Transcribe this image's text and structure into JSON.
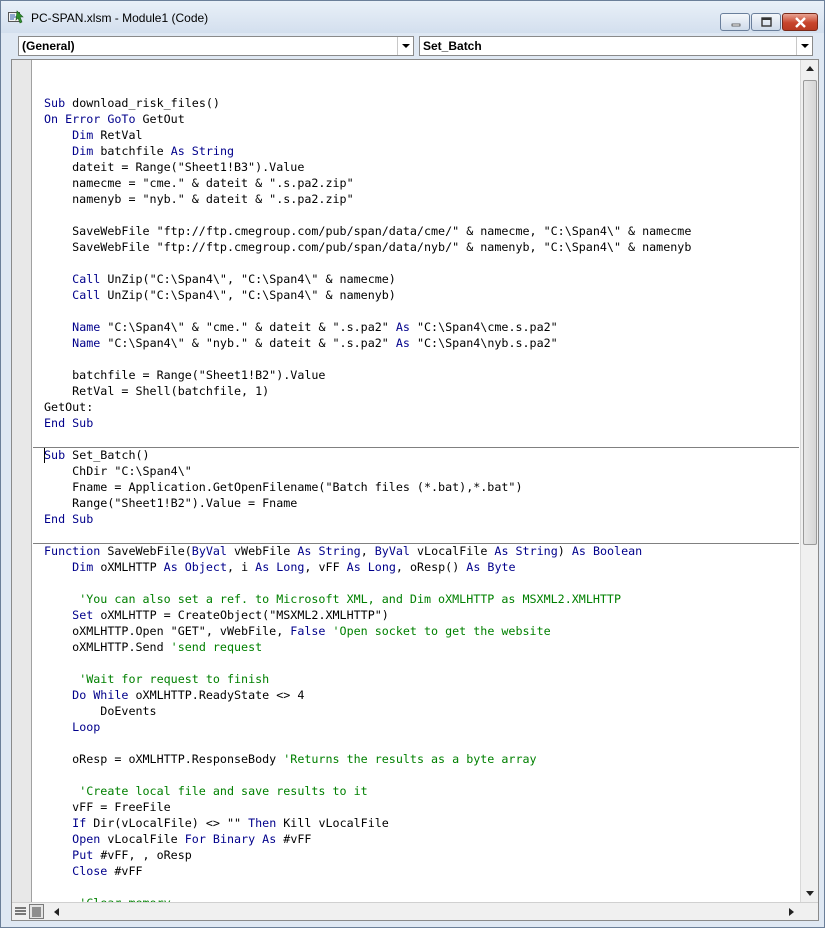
{
  "window": {
    "title": "PC-SPAN.xlsm - Module1 (Code)",
    "icon": "vba-module-icon",
    "accent_close": "#c8452c"
  },
  "combos": {
    "object": "(General)",
    "procedure": "Set_Batch"
  },
  "code_lines": [
    [
      [
        "",
        "plain"
      ]
    ],
    [
      [
        "Sub",
        "kw"
      ],
      [
        " download_risk_files()",
        "plain"
      ]
    ],
    [
      [
        "On Error GoTo",
        "kw"
      ],
      [
        " GetOut",
        "plain"
      ]
    ],
    [
      [
        "    ",
        "plain"
      ],
      [
        "Dim",
        "kw"
      ],
      [
        " RetVal",
        "plain"
      ]
    ],
    [
      [
        "    ",
        "plain"
      ],
      [
        "Dim",
        "kw"
      ],
      [
        " batchfile ",
        "plain"
      ],
      [
        "As String",
        "kw"
      ]
    ],
    [
      [
        "    dateit = Range(\"Sheet1!B3\").Value",
        "plain"
      ]
    ],
    [
      [
        "    namecme = \"cme.\" & dateit & \".s.pa2.zip\"",
        "plain"
      ]
    ],
    [
      [
        "    namenyb = \"nyb.\" & dateit & \".s.pa2.zip\"",
        "plain"
      ]
    ],
    [
      [
        "",
        "plain"
      ]
    ],
    [
      [
        "    SaveWebFile \"ftp://ftp.cmegroup.com/pub/span/data/cme/\" & namecme, \"C:\\Span4\\\" & namecme",
        "plain"
      ]
    ],
    [
      [
        "    SaveWebFile \"ftp://ftp.cmegroup.com/pub/span/data/nyb/\" & namenyb, \"C:\\Span4\\\" & namenyb",
        "plain"
      ]
    ],
    [
      [
        "",
        "plain"
      ]
    ],
    [
      [
        "    ",
        "plain"
      ],
      [
        "Call",
        "kw"
      ],
      [
        " UnZip(\"C:\\Span4\\\", \"C:\\Span4\\\" & namecme)",
        "plain"
      ]
    ],
    [
      [
        "    ",
        "plain"
      ],
      [
        "Call",
        "kw"
      ],
      [
        " UnZip(\"C:\\Span4\\\", \"C:\\Span4\\\" & namenyb)",
        "plain"
      ]
    ],
    [
      [
        "",
        "plain"
      ]
    ],
    [
      [
        "    ",
        "plain"
      ],
      [
        "Name",
        "kw"
      ],
      [
        " \"C:\\Span4\\\" & \"cme.\" & dateit & \".s.pa2\" ",
        "plain"
      ],
      [
        "As",
        "kw"
      ],
      [
        " \"C:\\Span4\\cme.s.pa2\"",
        "plain"
      ]
    ],
    [
      [
        "    ",
        "plain"
      ],
      [
        "Name",
        "kw"
      ],
      [
        " \"C:\\Span4\\\" & \"nyb.\" & dateit & \".s.pa2\" ",
        "plain"
      ],
      [
        "As",
        "kw"
      ],
      [
        " \"C:\\Span4\\nyb.s.pa2\"",
        "plain"
      ]
    ],
    [
      [
        "",
        "plain"
      ]
    ],
    [
      [
        "    batchfile = Range(\"Sheet1!B2\").Value",
        "plain"
      ]
    ],
    [
      [
        "    RetVal = Shell(batchfile, 1)",
        "plain"
      ]
    ],
    [
      [
        "GetOut:",
        "plain"
      ]
    ],
    [
      [
        "End Sub",
        "kw"
      ]
    ],
    [
      [
        "",
        "plain"
      ]
    ],
    [
      [
        "Sub",
        "kw"
      ],
      [
        " Set_Batch()",
        "plain"
      ]
    ],
    [
      [
        "    ChDir \"C:\\Span4\\\"",
        "plain"
      ]
    ],
    [
      [
        "    Fname = Application.GetOpenFilename(\"Batch files (*.bat),*.bat\")",
        "plain"
      ]
    ],
    [
      [
        "    Range(\"Sheet1!B2\").Value = Fname",
        "plain"
      ]
    ],
    [
      [
        "End Sub",
        "kw"
      ]
    ],
    [
      [
        "",
        "plain"
      ]
    ],
    [
      [
        "Function",
        "kw"
      ],
      [
        " SaveWebFile(",
        "plain"
      ],
      [
        "ByVal",
        "kw"
      ],
      [
        " vWebFile ",
        "plain"
      ],
      [
        "As String",
        "kw"
      ],
      [
        ", ",
        "plain"
      ],
      [
        "ByVal",
        "kw"
      ],
      [
        " vLocalFile ",
        "plain"
      ],
      [
        "As String",
        "kw"
      ],
      [
        ") ",
        "plain"
      ],
      [
        "As Boolean",
        "kw"
      ]
    ],
    [
      [
        "    ",
        "plain"
      ],
      [
        "Dim",
        "kw"
      ],
      [
        " oXMLHTTP ",
        "plain"
      ],
      [
        "As Object",
        "kw"
      ],
      [
        ", i ",
        "plain"
      ],
      [
        "As Long",
        "kw"
      ],
      [
        ", vFF ",
        "plain"
      ],
      [
        "As Long",
        "kw"
      ],
      [
        ", oResp() ",
        "plain"
      ],
      [
        "As Byte",
        "kw"
      ]
    ],
    [
      [
        "",
        "plain"
      ]
    ],
    [
      [
        "     ",
        "plain"
      ],
      [
        "'You can also set a ref. to Microsoft XML, and Dim oXMLHTTP as MSXML2.XMLHTTP",
        "cm"
      ]
    ],
    [
      [
        "    ",
        "plain"
      ],
      [
        "Set",
        "kw"
      ],
      [
        " oXMLHTTP = CreateObject(\"MSXML2.XMLHTTP\")",
        "plain"
      ]
    ],
    [
      [
        "    oXMLHTTP.Open \"GET\", vWebFile, ",
        "plain"
      ],
      [
        "False",
        "kw"
      ],
      [
        " ",
        "plain"
      ],
      [
        "'Open socket to get the website",
        "cm"
      ]
    ],
    [
      [
        "    oXMLHTTP.Send ",
        "plain"
      ],
      [
        "'send request",
        "cm"
      ]
    ],
    [
      [
        "",
        "plain"
      ]
    ],
    [
      [
        "     ",
        "plain"
      ],
      [
        "'Wait for request to finish",
        "cm"
      ]
    ],
    [
      [
        "    ",
        "plain"
      ],
      [
        "Do While",
        "kw"
      ],
      [
        " oXMLHTTP.ReadyState <> 4",
        "plain"
      ]
    ],
    [
      [
        "        DoEvents",
        "plain"
      ]
    ],
    [
      [
        "    ",
        "plain"
      ],
      [
        "Loop",
        "kw"
      ]
    ],
    [
      [
        "",
        "plain"
      ]
    ],
    [
      [
        "    oResp = oXMLHTTP.ResponseBody ",
        "plain"
      ],
      [
        "'Returns the results as a byte array",
        "cm"
      ]
    ],
    [
      [
        "",
        "plain"
      ]
    ],
    [
      [
        "     ",
        "plain"
      ],
      [
        "'Create local file and save results to it",
        "cm"
      ]
    ],
    [
      [
        "    vFF = FreeFile",
        "plain"
      ]
    ],
    [
      [
        "    ",
        "plain"
      ],
      [
        "If",
        "kw"
      ],
      [
        " Dir(vLocalFile) <> \"\" ",
        "plain"
      ],
      [
        "Then",
        "kw"
      ],
      [
        " Kill vLocalFile",
        "plain"
      ]
    ],
    [
      [
        "    ",
        "plain"
      ],
      [
        "Open",
        "kw"
      ],
      [
        " vLocalFile ",
        "plain"
      ],
      [
        "For Binary As",
        "kw"
      ],
      [
        " #vFF",
        "plain"
      ]
    ],
    [
      [
        "    ",
        "plain"
      ],
      [
        "Put",
        "kw"
      ],
      [
        " #vFF, , oResp",
        "plain"
      ]
    ],
    [
      [
        "    ",
        "plain"
      ],
      [
        "Close",
        "kw"
      ],
      [
        " #vFF",
        "plain"
      ]
    ],
    [
      [
        "",
        "plain"
      ]
    ],
    [
      [
        "     ",
        "plain"
      ],
      [
        "'Clear memory",
        "cm"
      ]
    ]
  ],
  "separators_after_line": [
    22,
    28
  ],
  "icons": {
    "minimize": "minimize-icon",
    "maximize": "maximize-icon",
    "close": "close-icon",
    "dropdown": "chevron-down-icon",
    "scroll_up": "scroll-up-arrow-icon",
    "scroll_down": "scroll-down-arrow-icon",
    "scroll_left": "scroll-left-arrow-icon",
    "scroll_right": "scroll-right-arrow-icon",
    "procedure_view": "procedure-view-icon",
    "full_module_view": "full-module-view-icon"
  }
}
